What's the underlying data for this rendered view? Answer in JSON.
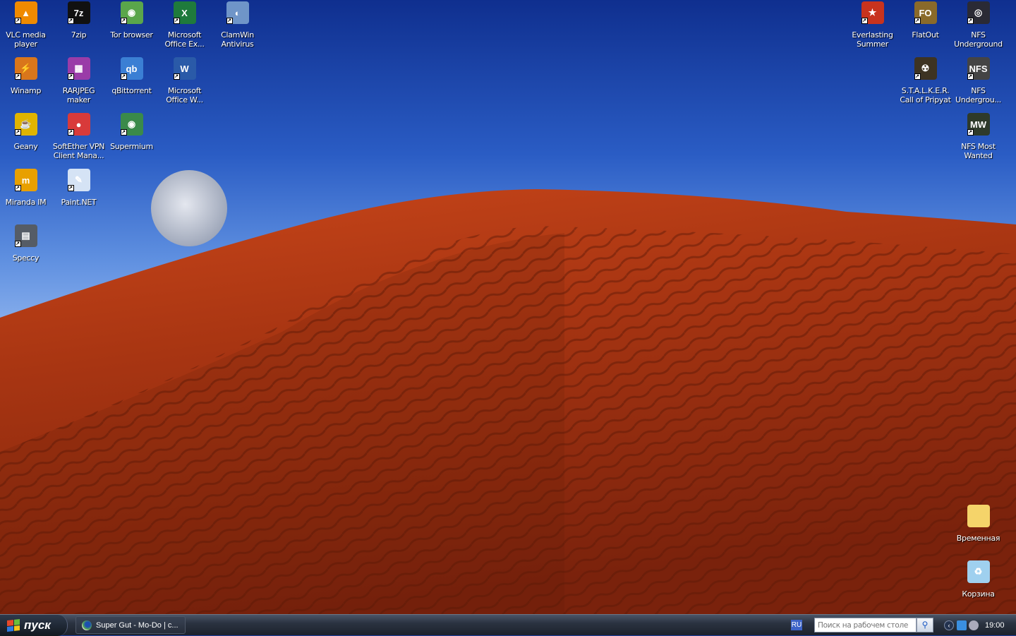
{
  "desktop": {
    "icons_left": [
      {
        "label": "VLC media player",
        "icon": "vlc-icon",
        "color": "#f08a00",
        "glyph": "▲"
      },
      {
        "label": "7zip",
        "icon": "7zip-icon",
        "color": "#111111",
        "glyph": "7z"
      },
      {
        "label": "Tor browser",
        "icon": "tor-icon",
        "color": "#5aa64b",
        "glyph": "◉"
      },
      {
        "label": "Microsoft Office Ex...",
        "icon": "excel-icon",
        "color": "#1f7a3c",
        "glyph": "X"
      },
      {
        "label": "ClamWin Antivirus",
        "icon": "clamwin-icon",
        "color": "#6f95c8",
        "glyph": "◐"
      },
      {
        "label": "Winamp",
        "icon": "winamp-icon",
        "color": "#d9761b",
        "glyph": "⚡"
      },
      {
        "label": "RARJPEG maker",
        "icon": "rarjpeg-icon",
        "color": "#9a3ca8",
        "glyph": "▦"
      },
      {
        "label": "qBittorrent",
        "icon": "qbittorrent-icon",
        "color": "#3b7fd4",
        "glyph": "qb"
      },
      {
        "label": "Microsoft Office W...",
        "icon": "word-icon",
        "color": "#2a5aa8",
        "glyph": "W"
      },
      {
        "label": "Geany",
        "icon": "geany-icon",
        "color": "#e0b400",
        "glyph": "☕"
      },
      {
        "label": "SoftEther VPN Client Mana...",
        "icon": "softether-icon",
        "color": "#d83a3a",
        "glyph": "●"
      },
      {
        "label": "Supermium",
        "icon": "supermium-icon",
        "color": "#3a8a4a",
        "glyph": "◉"
      },
      {
        "label": "Miranda IM",
        "icon": "miranda-icon",
        "color": "#e8a000",
        "glyph": "m"
      },
      {
        "label": "Paint.NET",
        "icon": "paintnet-icon",
        "color": "#d5e3f5",
        "glyph": "✎"
      },
      {
        "label": "Speccy",
        "icon": "speccy-icon",
        "color": "#555c66",
        "glyph": "▤"
      }
    ],
    "icons_right": [
      {
        "label": "Everlasting Summer",
        "icon": "everlasting-summer-icon",
        "color": "#c8331e",
        "glyph": "★"
      },
      {
        "label": "FlatOut",
        "icon": "flatout-icon",
        "color": "#8a6a2a",
        "glyph": "FO"
      },
      {
        "label": "NFS Underground",
        "icon": "nfs-underground-icon",
        "color": "#2a2a35",
        "glyph": "◎"
      },
      {
        "label": "S.T.A.L.K.E.R. Call of Pripyat",
        "icon": "stalker-icon",
        "color": "#3d3322",
        "glyph": "☢"
      },
      {
        "label": "NFS Undergrou...",
        "icon": "nfs-underground2-icon",
        "color": "#444",
        "glyph": "NFS"
      },
      {
        "label": "NFS Most Wanted",
        "icon": "nfs-most-wanted-icon",
        "color": "#2e3a2a",
        "glyph": "MW"
      },
      {
        "label": "Временная",
        "icon": "folder-icon",
        "color": "#f5d46a",
        "glyph": ""
      },
      {
        "label": "Корзина",
        "icon": "recycle-bin-icon",
        "color": "#9fd0ef",
        "glyph": "♻"
      }
    ]
  },
  "taskbar": {
    "start_label": "пуск",
    "task_label": "Super Gut - Mo-Do | c...",
    "lang": "RU",
    "search_placeholder": "Поиск на рабочем столе",
    "clock": "19:00"
  }
}
